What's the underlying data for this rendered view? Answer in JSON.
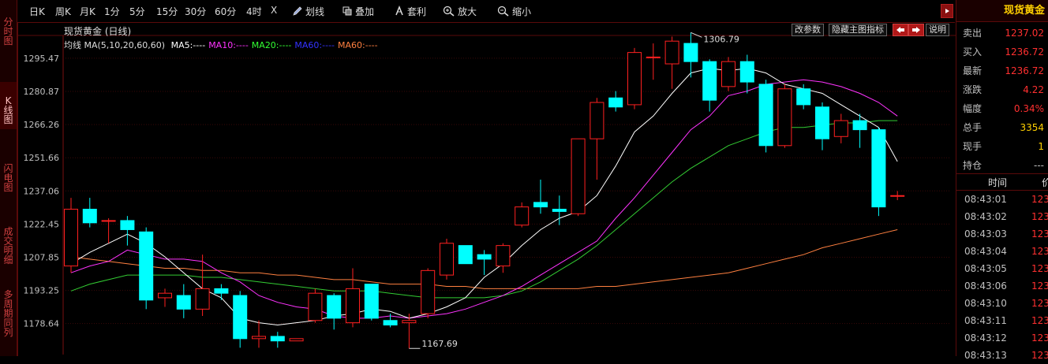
{
  "toolbar": {
    "periods": [
      "日K",
      "周K",
      "月K",
      "1分",
      "5分",
      "15分",
      "30分",
      "60分",
      "4时",
      "X"
    ],
    "tools": [
      {
        "label": "划线",
        "icon": "pencil-icon"
      },
      {
        "label": "叠加",
        "icon": "overlay-icon"
      },
      {
        "label": "套利",
        "icon": "arbitrage-icon"
      },
      {
        "label": "放大",
        "icon": "zoom-in-icon"
      },
      {
        "label": "缩小",
        "icon": "zoom-out-icon"
      }
    ]
  },
  "left_tabs": [
    {
      "label": "分时图",
      "active": false
    },
    {
      "label": "K线图",
      "active": true
    },
    {
      "label": "闪电图",
      "active": false
    },
    {
      "label": "成交明细",
      "active": false
    },
    {
      "label": "多周期同列",
      "active": false
    }
  ],
  "chart": {
    "title": "现货黄金 (日线)",
    "ma_prefix": "均线 MA(5,10,20,60,60)",
    "ma_items": [
      {
        "text": "MA5:----",
        "color": "#ffffff"
      },
      {
        "text": "MA10:----",
        "color": "#ff33ff"
      },
      {
        "text": "MA20:----",
        "color": "#33ff33"
      },
      {
        "text": "MA60:----",
        "color": "#3333ff"
      },
      {
        "text": "MA60:----",
        "color": "#ff8040"
      }
    ],
    "buttons": {
      "params": "改参数",
      "hide": "隐藏主图指标",
      "help": "说明"
    },
    "up_color": "#ff2020",
    "down_color": "#00ffff"
  },
  "chart_data": {
    "type": "candlestick",
    "title": "现货黄金 (日线)",
    "y_ticks": [
      1295.47,
      1280.87,
      1266.26,
      1251.66,
      1237.06,
      1222.45,
      1207.85,
      1193.25,
      1178.64
    ],
    "y_range": [
      1165.0,
      1305.5
    ],
    "annotations": {
      "high": "1306.79",
      "low": "1167.69"
    },
    "candles": [
      {
        "o": 1204,
        "h": 1234,
        "l": 1201,
        "c": 1229
      },
      {
        "o": 1229,
        "h": 1234,
        "l": 1221,
        "c": 1223
      },
      {
        "o": 1224,
        "h": 1225,
        "l": 1214,
        "c": 1224
      },
      {
        "o": 1224,
        "h": 1226,
        "l": 1213,
        "c": 1220
      },
      {
        "o": 1219,
        "h": 1221,
        "l": 1185,
        "c": 1189
      },
      {
        "o": 1190,
        "h": 1194,
        "l": 1186,
        "c": 1192
      },
      {
        "o": 1191,
        "h": 1196,
        "l": 1181,
        "c": 1185
      },
      {
        "o": 1185,
        "h": 1209,
        "l": 1182,
        "c": 1194
      },
      {
        "o": 1194,
        "h": 1196,
        "l": 1189,
        "c": 1192
      },
      {
        "o": 1191,
        "h": 1193,
        "l": 1168,
        "c": 1172
      },
      {
        "o": 1172,
        "h": 1180,
        "l": 1168,
        "c": 1173
      },
      {
        "o": 1173,
        "h": 1175,
        "l": 1168,
        "c": 1171
      },
      {
        "o": 1171,
        "h": 1172,
        "l": 1171,
        "c": 1172
      },
      {
        "o": 1180,
        "h": 1194,
        "l": 1179,
        "c": 1192
      },
      {
        "o": 1191,
        "h": 1192,
        "l": 1176,
        "c": 1181
      },
      {
        "o": 1179,
        "h": 1203,
        "l": 1177,
        "c": 1194
      },
      {
        "o": 1196,
        "h": 1196,
        "l": 1180,
        "c": 1181
      },
      {
        "o": 1180,
        "h": 1183,
        "l": 1177,
        "c": 1178
      },
      {
        "o": 1179,
        "h": 1183,
        "l": 1167.69,
        "c": 1180
      },
      {
        "o": 1183,
        "h": 1203,
        "l": 1181,
        "c": 1202
      },
      {
        "o": 1200,
        "h": 1216,
        "l": 1198,
        "c": 1214
      },
      {
        "o": 1213,
        "h": 1213,
        "l": 1205,
        "c": 1205
      },
      {
        "o": 1209,
        "h": 1211,
        "l": 1200,
        "c": 1207
      },
      {
        "o": 1204,
        "h": 1214,
        "l": 1201,
        "c": 1213
      },
      {
        "o": 1222,
        "h": 1232,
        "l": 1221,
        "c": 1230
      },
      {
        "o": 1232,
        "h": 1242,
        "l": 1227,
        "c": 1230
      },
      {
        "o": 1229,
        "h": 1235,
        "l": 1222,
        "c": 1228
      },
      {
        "o": 1227,
        "h": 1258,
        "l": 1226,
        "c": 1260
      },
      {
        "o": 1260,
        "h": 1278,
        "l": 1242,
        "c": 1276
      },
      {
        "o": 1278,
        "h": 1281,
        "l": 1272,
        "c": 1274
      },
      {
        "o": 1275,
        "h": 1300,
        "l": 1273,
        "c": 1298
      },
      {
        "o": 1296,
        "h": 1302,
        "l": 1286,
        "c": 1296
      },
      {
        "o": 1293,
        "h": 1305,
        "l": 1282,
        "c": 1303
      },
      {
        "o": 1302,
        "h": 1306.79,
        "l": 1287,
        "c": 1294
      },
      {
        "o": 1294,
        "h": 1295,
        "l": 1272,
        "c": 1277
      },
      {
        "o": 1283,
        "h": 1296,
        "l": 1281,
        "c": 1294
      },
      {
        "o": 1294,
        "h": 1297,
        "l": 1280,
        "c": 1285
      },
      {
        "o": 1284,
        "h": 1286,
        "l": 1254,
        "c": 1257
      },
      {
        "o": 1257,
        "h": 1284,
        "l": 1256,
        "c": 1282
      },
      {
        "o": 1282,
        "h": 1284,
        "l": 1273,
        "c": 1275
      },
      {
        "o": 1274,
        "h": 1276,
        "l": 1255,
        "c": 1260
      },
      {
        "o": 1261,
        "h": 1271,
        "l": 1258,
        "c": 1268
      },
      {
        "o": 1268,
        "h": 1271,
        "l": 1256,
        "c": 1264
      },
      {
        "o": 1264,
        "h": 1265,
        "l": 1226,
        "c": 1230
      },
      {
        "o": 1235,
        "h": 1237,
        "l": 1233,
        "c": 1235
      }
    ],
    "ma5": [
      1205,
      1210,
      1214,
      1218,
      1214,
      1208,
      1201,
      1194,
      1190,
      1181,
      1179,
      1178,
      1179,
      1180,
      1182,
      1183,
      1185,
      1184,
      1181,
      1183,
      1186,
      1190,
      1199,
      1205,
      1213,
      1220,
      1225,
      1228,
      1235,
      1248,
      1263,
      1270,
      1280,
      1289,
      1291,
      1290,
      1291,
      1289,
      1284,
      1282,
      1280,
      1275,
      1270,
      1265,
      1250
    ],
    "ma10": [
      1201,
      1204,
      1206,
      1211,
      1209,
      1207,
      1207,
      1206,
      1201,
      1197,
      1191,
      1188,
      1186,
      1185,
      1182,
      1181,
      1181,
      1182,
      1181,
      1182,
      1183,
      1185,
      1188,
      1191,
      1195,
      1200,
      1205,
      1210,
      1215,
      1225,
      1234,
      1244,
      1254,
      1264,
      1270,
      1279,
      1281,
      1284,
      1285,
      1286,
      1285,
      1283,
      1280,
      1276,
      1270
    ],
    "ma20": [
      1193,
      1196,
      1198,
      1200,
      1200,
      1200,
      1200,
      1199,
      1199,
      1198,
      1197,
      1196,
      1195,
      1194,
      1193,
      1193,
      1193,
      1192,
      1191,
      1190,
      1190,
      1190,
      1190,
      1191,
      1193,
      1197,
      1202,
      1207,
      1213,
      1220,
      1227,
      1234,
      1241,
      1247,
      1252,
      1257,
      1260,
      1263,
      1265,
      1265,
      1266,
      1267,
      1267,
      1268,
      1268
    ],
    "ma60b": [
      1208,
      1207,
      1206,
      1205,
      1204,
      1203,
      1203,
      1202,
      1202,
      1201,
      1201,
      1200,
      1200,
      1199,
      1198,
      1198,
      1197,
      1196,
      1196,
      1196,
      1195,
      1195,
      1194,
      1194,
      1194,
      1194,
      1194,
      1194,
      1195,
      1195,
      1196,
      1197,
      1198,
      1199,
      1200,
      1201,
      1203,
      1205,
      1207,
      1209,
      1212,
      1214,
      1216,
      1218,
      1220
    ]
  },
  "quote": {
    "name": "现货黄金",
    "rows": [
      {
        "label": "卖出",
        "value": "1237.02",
        "color": "#ff3030"
      },
      {
        "label": "买入",
        "value": "1236.72",
        "color": "#ff3030"
      },
      {
        "label": "最新",
        "value": "1236.72",
        "color": "#ff3030"
      },
      {
        "label": "涨跌",
        "value": "4.22",
        "color": "#ff3030"
      },
      {
        "label": "幅度",
        "value": "0.34%",
        "color": "#ff3030"
      },
      {
        "label": "总手",
        "value": "3354",
        "color": "#ffd000"
      },
      {
        "label": "现手",
        "value": "1",
        "color": "#ffd000"
      },
      {
        "label": "持仓",
        "value": "---",
        "color": "#c0c0c0"
      }
    ],
    "tick_header": {
      "time": "时间",
      "price": "价"
    },
    "ticks": [
      {
        "time": "08:43:01",
        "price": "123"
      },
      {
        "time": "08:43:02",
        "price": "123"
      },
      {
        "time": "08:43:03",
        "price": "123"
      },
      {
        "time": "08:43:04",
        "price": "123"
      },
      {
        "time": "08:43:05",
        "price": "123"
      },
      {
        "time": "08:43:06",
        "price": "123"
      },
      {
        "time": "08:43:10",
        "price": "123"
      },
      {
        "time": "08:43:11",
        "price": "123"
      },
      {
        "time": "08:43:12",
        "price": "123"
      },
      {
        "time": "08:43:13",
        "price": "123"
      }
    ]
  }
}
